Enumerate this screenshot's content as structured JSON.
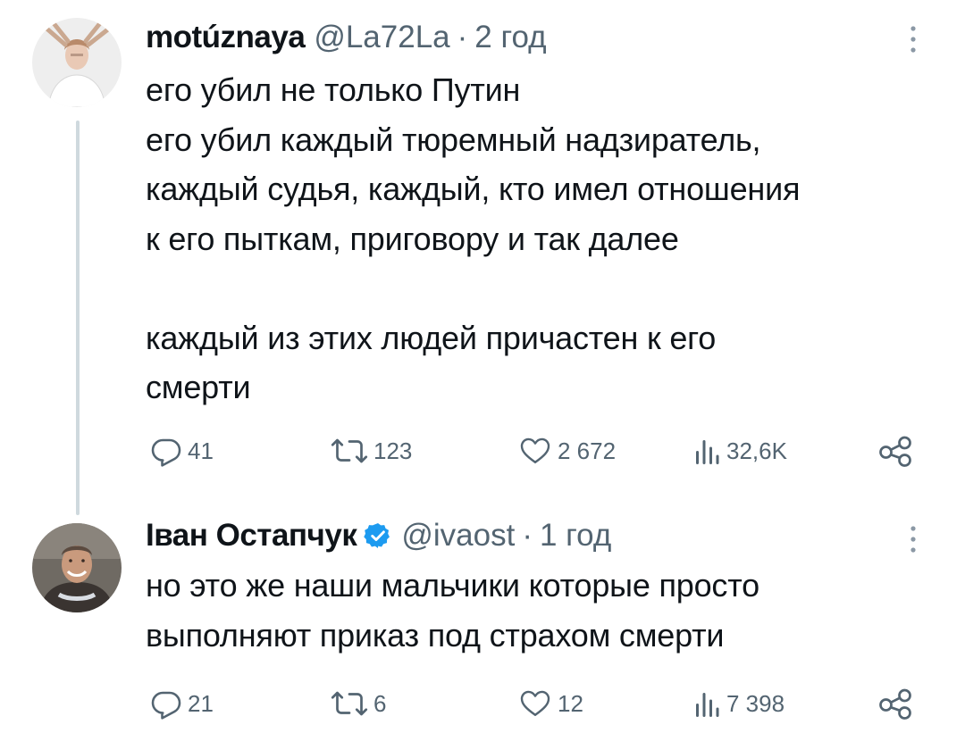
{
  "tweets": [
    {
      "display_name": "motúznaya",
      "handle": "@La72La",
      "separator": "·",
      "time": "2 год",
      "verified": false,
      "text_lines": [
        "его убил не только Путин",
        "его убил каждый тюремный надзиратель,",
        "каждый судья, каждый, кто имел отношения",
        "к его пыткам, приговору и так далее",
        "",
        "каждый из этих людей причастен к его",
        "смерти"
      ],
      "replies": "41",
      "retweets": "123",
      "likes": "2 672",
      "views": "32,6K"
    },
    {
      "display_name": "Іван Остапчук",
      "handle": "@ivaost",
      "separator": "·",
      "time": "1 год",
      "verified": true,
      "text_lines": [
        "но это же наши мальчики которые просто",
        "выполняют приказ под страхом смерти"
      ],
      "replies": "21",
      "retweets": "6",
      "likes": "12",
      "views": "7 398"
    }
  ],
  "colors": {
    "text": "#0f1419",
    "secondary": "#536471",
    "verified": "#1d9bf0",
    "thread_line": "#cfd9de"
  },
  "icons": [
    "reply-icon",
    "retweet-icon",
    "like-icon",
    "views-icon",
    "share-icon",
    "more-icon",
    "verified-icon"
  ]
}
